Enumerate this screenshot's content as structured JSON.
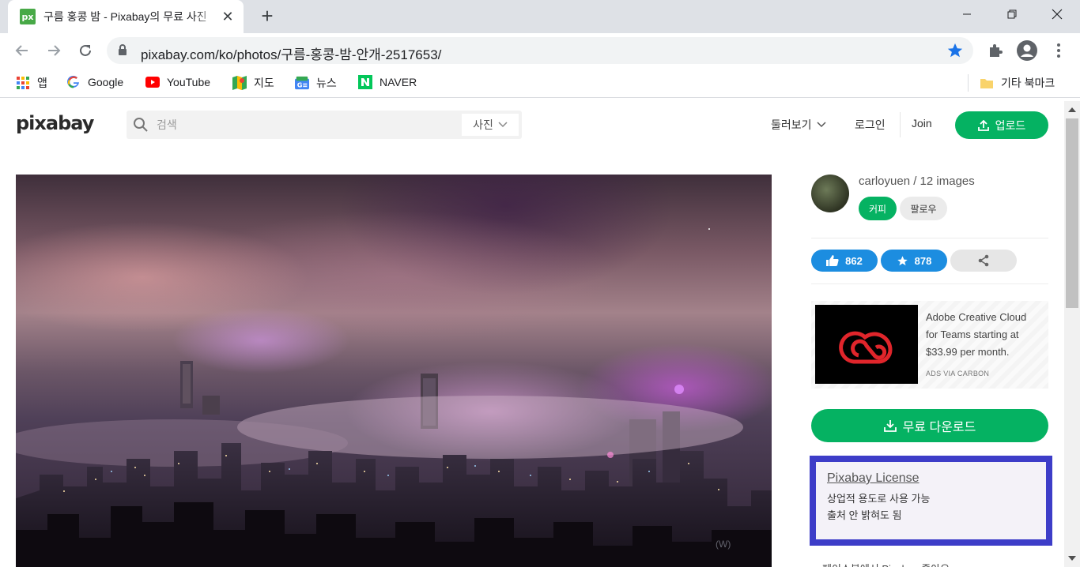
{
  "browser": {
    "tab_title": "구름 홍콩 밤 - Pixabay의 무료 사진",
    "tab_favicon_text": "px",
    "url": "pixabay.com/ko/photos/구름-홍콩-밤-안개-2517653/",
    "bookmarks": [
      {
        "label": "앱",
        "icon": "apps-grid-icon"
      },
      {
        "label": "Google",
        "icon": "google-icon"
      },
      {
        "label": "YouTube",
        "icon": "youtube-icon"
      },
      {
        "label": "지도",
        "icon": "maps-icon"
      },
      {
        "label": "뉴스",
        "icon": "news-icon"
      },
      {
        "label": "NAVER",
        "icon": "naver-icon"
      }
    ],
    "other_bookmarks": "기타 북마크"
  },
  "header": {
    "logo": "pixabay",
    "search_placeholder": "검색",
    "search_type": "사진",
    "explore": "둘러보기",
    "login": "로그인",
    "join": "Join",
    "upload": "업로드"
  },
  "author": {
    "name": "carloyuen / 12 images",
    "coffee": "커피",
    "follow": "팔로우"
  },
  "stats": {
    "likes": "862",
    "favorites": "878"
  },
  "ad": {
    "text": "Adobe Creative Cloud for Teams starting at $33.99 per month.",
    "via": "ADS VIA CARBON"
  },
  "download": "무료 다운로드",
  "license": {
    "title": "Pixabay License",
    "line1": "상업적 용도로 사용 가능",
    "line2": "출처 안 밝혀도 됨"
  },
  "watermark": "(W)",
  "cut_text": "페이스북에서 Pixabay 좋아요",
  "colors": {
    "brand_green": "#05b262",
    "stat_blue": "#1c8de0",
    "license_border": "#3d3dc8"
  }
}
